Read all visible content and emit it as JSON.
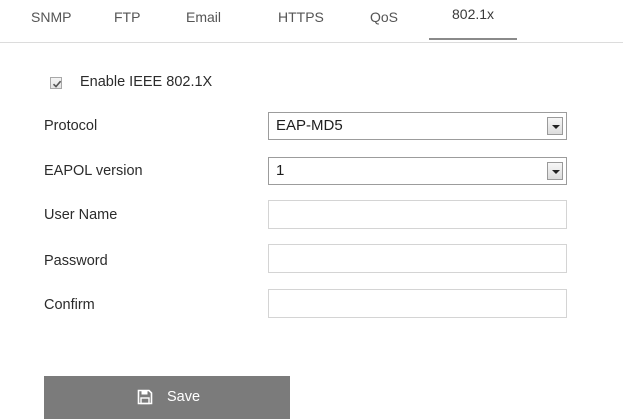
{
  "tabs": [
    {
      "label": "SNMP",
      "active": false
    },
    {
      "label": "FTP",
      "active": false
    },
    {
      "label": "Email",
      "active": false
    },
    {
      "label": "HTTPS",
      "active": false
    },
    {
      "label": "QoS",
      "active": false
    },
    {
      "label": "802.1x",
      "active": true
    }
  ],
  "form": {
    "enable_label": "Enable IEEE 802.1X",
    "enable_checked": true,
    "protocol": {
      "label": "Protocol",
      "value": "EAP-MD5"
    },
    "eapol_version": {
      "label": "EAPOL version",
      "value": "1"
    },
    "user_name": {
      "label": "User Name",
      "value": ""
    },
    "password": {
      "label": "Password",
      "value": ""
    },
    "confirm": {
      "label": "Confirm",
      "value": ""
    }
  },
  "save": {
    "label": "Save",
    "icon": "floppy-disk-icon"
  },
  "colors": {
    "button_bg": "#7b7b7b",
    "active_tab_underline": "#8a8a8a",
    "divider": "#dcdcdc"
  }
}
